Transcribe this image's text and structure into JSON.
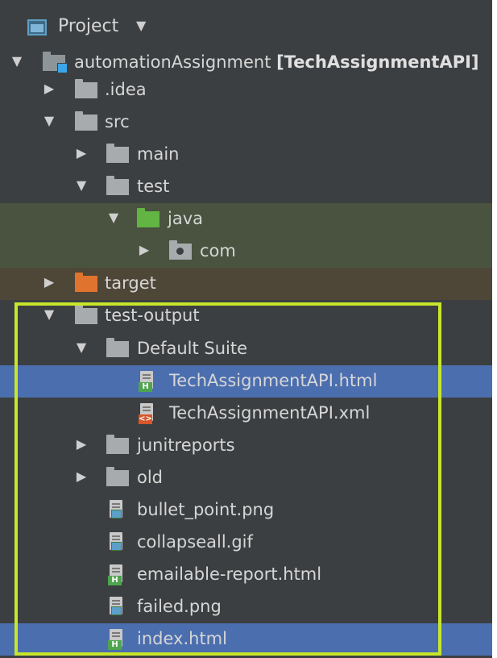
{
  "panel": {
    "title": "Project",
    "title_icon": "project-window-icon",
    "dropdown_icon": "chevron-down-icon"
  },
  "tree": {
    "root_name": "automationAssignment",
    "root_module": "[TechAssignmentAPI]",
    "items": [
      {
        "label": "automationAssignment",
        "icon": "module-folder-icon",
        "expanded": true
      },
      {
        "label": ".idea",
        "icon": "folder-icon",
        "expanded": false
      },
      {
        "label": "src",
        "icon": "folder-icon",
        "expanded": true
      },
      {
        "label": "main",
        "icon": "folder-icon",
        "expanded": false
      },
      {
        "label": "test",
        "icon": "folder-icon",
        "expanded": true
      },
      {
        "label": "java",
        "icon": "test-source-folder-icon",
        "expanded": true
      },
      {
        "label": "com",
        "icon": "package-icon",
        "expanded": false
      },
      {
        "label": "target",
        "icon": "excluded-folder-icon",
        "expanded": false
      },
      {
        "label": "test-output",
        "icon": "folder-icon",
        "expanded": true
      },
      {
        "label": "Default Suite",
        "icon": "folder-icon",
        "expanded": true
      },
      {
        "label": "TechAssignmentAPI.html",
        "icon": "html-file-icon",
        "selected": true
      },
      {
        "label": "TechAssignmentAPI.xml",
        "icon": "xml-file-icon"
      },
      {
        "label": "junitreports",
        "icon": "folder-icon",
        "expanded": false
      },
      {
        "label": "old",
        "icon": "folder-icon",
        "expanded": false
      },
      {
        "label": "bullet_point.png",
        "icon": "image-file-icon"
      },
      {
        "label": "collapseall.gif",
        "icon": "image-file-icon"
      },
      {
        "label": "emailable-report.html",
        "icon": "html-file-icon"
      },
      {
        "label": "failed.png",
        "icon": "image-file-icon"
      },
      {
        "label": "index.html",
        "icon": "html-file-icon",
        "selected": true
      }
    ]
  },
  "colors": {
    "background": "#3c3f41",
    "selection": "#4b6eaf",
    "test_root_bg": "#49533f",
    "excluded_bg": "#4e4637",
    "highlight_box": "#c8e62a"
  }
}
